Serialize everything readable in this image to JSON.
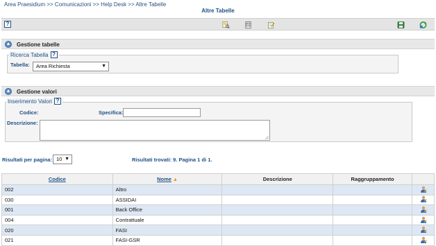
{
  "breadcrumb": "Area Praesidium >> Comunicazioni >> Help Desk >> Altre Tabelle",
  "page_title": "Altre Tabelle",
  "toolbar": {
    "help": "?"
  },
  "gestione_tabelle": {
    "title": "Gestione tabelle",
    "legend": "Ricerca Tabella",
    "help": "?",
    "tabella_label": "Tabella:",
    "tabella_value": "Area Richiesta"
  },
  "gestione_valori": {
    "title": "Gestione valori",
    "legend": "Inserimento Valori",
    "help": "?",
    "codice_label": "Codice:",
    "specifica_label": "Specifica:",
    "descrizione_label": "Descrizione:"
  },
  "results": {
    "per_page_label": "Risultati per pagina:",
    "per_page_value": "10",
    "summary": "Risultati trovati: 9. Pagina 1 di 1."
  },
  "table": {
    "headers": {
      "codice": "Codice",
      "nome": "Nome",
      "descrizione": "Descrizione",
      "raggruppamento": "Raggruppamento"
    },
    "rows": [
      {
        "codice": "002",
        "nome": "Altro",
        "descrizione": "",
        "raggruppamento": ""
      },
      {
        "codice": "030",
        "nome": "ASSIDAI",
        "descrizione": "",
        "raggruppamento": ""
      },
      {
        "codice": "001",
        "nome": "Back Office",
        "descrizione": "",
        "raggruppamento": ""
      },
      {
        "codice": "004",
        "nome": "Contrattuale",
        "descrizione": "",
        "raggruppamento": ""
      },
      {
        "codice": "020",
        "nome": "FASI",
        "descrizione": "",
        "raggruppamento": ""
      },
      {
        "codice": "021",
        "nome": "FASI-GSR",
        "descrizione": "",
        "raggruppamento": ""
      }
    ]
  },
  "colors": {
    "accent": "#1f4f86",
    "row_alt": "#dde8f4",
    "sort_arrow": "#e8921e"
  },
  "icons": [
    "help-icon",
    "search-doc-icon",
    "document-icon",
    "edit-note-icon",
    "save-icon",
    "refresh-icon",
    "edit-user-icon"
  ]
}
